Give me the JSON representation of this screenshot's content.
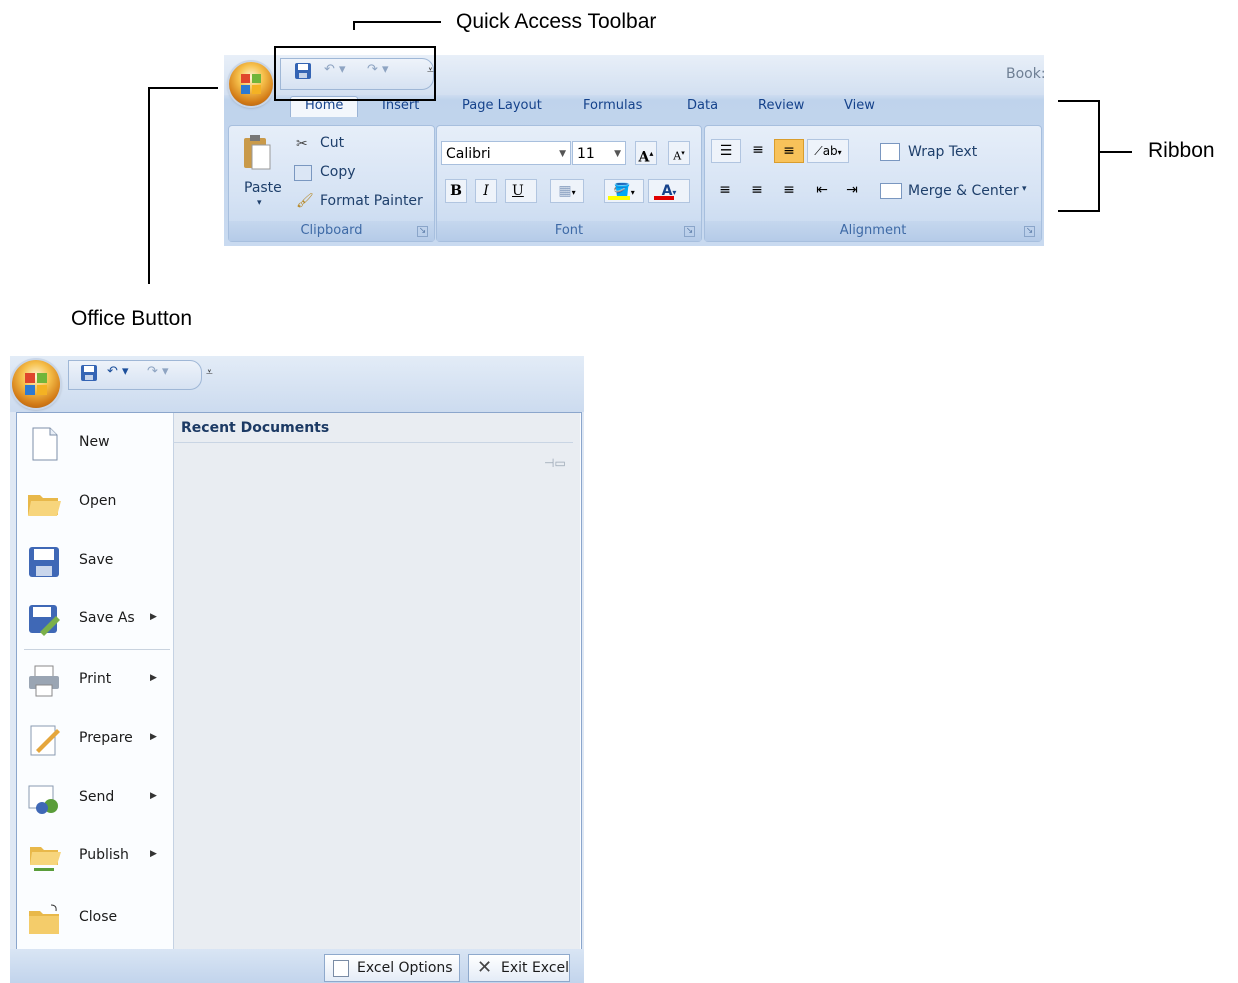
{
  "callouts": {
    "quick_access_toolbar": "Quick Access Toolbar",
    "ribbon": "Ribbon",
    "office_button": "Office Button"
  },
  "ribbon": {
    "title_partial": "Book:",
    "tabs": [
      {
        "label": "Home",
        "active": true
      },
      {
        "label": "Insert"
      },
      {
        "label": "Page Layout"
      },
      {
        "label": "Formulas"
      },
      {
        "label": "Data"
      },
      {
        "label": "Review"
      },
      {
        "label": "View"
      }
    ],
    "clipboard": {
      "caption": "Clipboard",
      "paste": "Paste",
      "cut": "Cut",
      "copy": "Copy",
      "format_painter": "Format Painter"
    },
    "font": {
      "caption": "Font",
      "font_name": "Calibri",
      "font_size": "11",
      "bold": "B",
      "italic": "I",
      "underline": "U",
      "grow": "A",
      "shrink": "A",
      "font_color": "A"
    },
    "alignment": {
      "caption": "Alignment",
      "wrap_text": "Wrap Text",
      "merge_center": "Merge & Center"
    }
  },
  "office_menu": {
    "recent_documents_title": "Recent Documents",
    "items": [
      {
        "label": "New",
        "icon": "new-document-icon",
        "submenu": false
      },
      {
        "label": "Open",
        "icon": "open-folder-icon",
        "submenu": false
      },
      {
        "label": "Save",
        "icon": "save-disk-icon",
        "submenu": false
      },
      {
        "label": "Save As",
        "icon": "save-as-icon",
        "submenu": true
      },
      {
        "label": "Print",
        "icon": "printer-icon",
        "submenu": true
      },
      {
        "label": "Prepare",
        "icon": "prepare-pencil-icon",
        "submenu": true
      },
      {
        "label": "Send",
        "icon": "send-icon",
        "submenu": true
      },
      {
        "label": "Publish",
        "icon": "publish-folder-icon",
        "submenu": true
      },
      {
        "label": "Close",
        "icon": "close-folder-icon",
        "submenu": false
      }
    ],
    "excel_options": "Excel Options",
    "exit_excel": "Exit Excel"
  },
  "colors": {
    "ribbon_text": "#15428b",
    "orb_orange": "#d27a16",
    "font_color_bar": "#e00000",
    "highlight_bar": "#ffff00"
  }
}
